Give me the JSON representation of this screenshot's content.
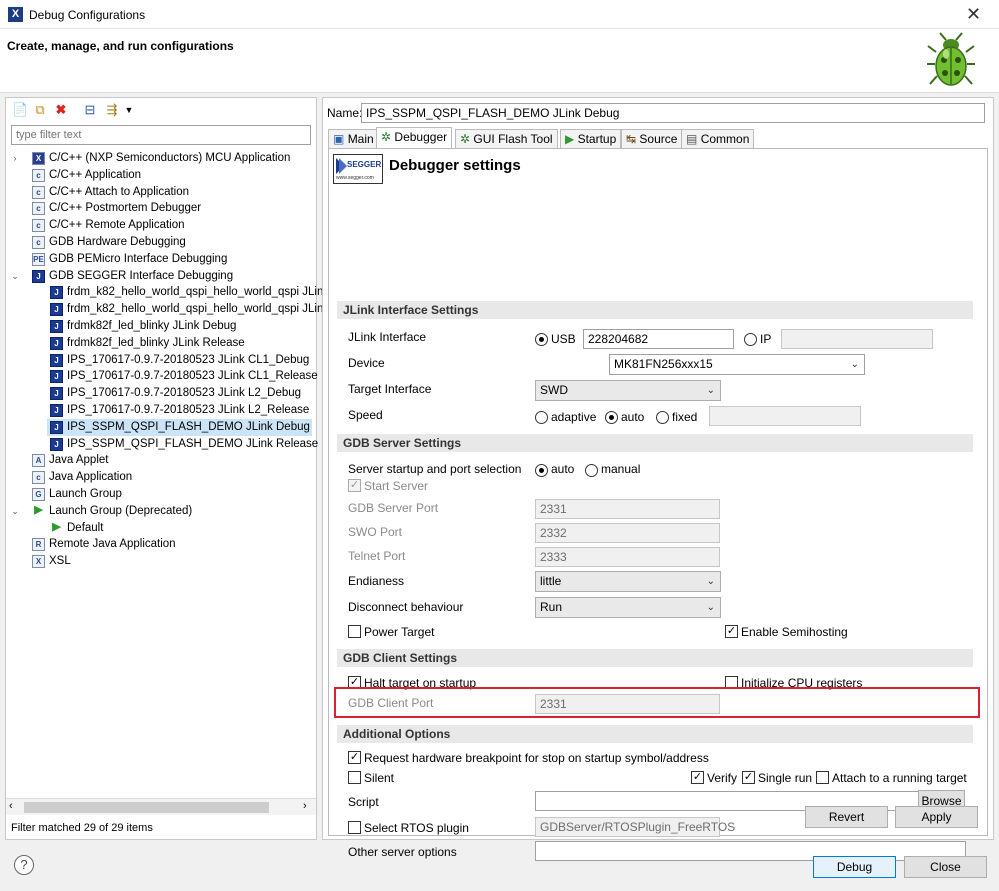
{
  "window": {
    "title": "Debug Configurations",
    "header": "Create, manage, and run configurations"
  },
  "sidebar": {
    "filter_placeholder": "type filter text",
    "items": [
      {
        "label": "C/C++ (NXP Semiconductors) MCU Application",
        "icon": "x",
        "level": 0,
        "twisty": "collapsed"
      },
      {
        "label": "C/C++ Application",
        "icon": "c",
        "level": 0
      },
      {
        "label": "C/C++ Attach to Application",
        "icon": "c",
        "level": 0
      },
      {
        "label": "C/C++ Postmortem Debugger",
        "icon": "c",
        "level": 0
      },
      {
        "label": "C/C++ Remote Application",
        "icon": "c",
        "level": 0
      },
      {
        "label": "GDB Hardware Debugging",
        "icon": "c",
        "level": 0
      },
      {
        "label": "GDB PEMicro Interface Debugging",
        "icon": "p",
        "level": 0
      },
      {
        "label": "GDB SEGGER Interface Debugging",
        "icon": "j",
        "level": 0,
        "twisty": "expanded"
      },
      {
        "label": "frdm_k82_hello_world_qspi_hello_world_qspi JLinl",
        "icon": "j",
        "level": 1
      },
      {
        "label": "frdm_k82_hello_world_qspi_hello_world_qspi JLinl",
        "icon": "j",
        "level": 1
      },
      {
        "label": "frdmk82f_led_blinky JLink Debug",
        "icon": "j",
        "level": 1
      },
      {
        "label": "frdmk82f_led_blinky JLink Release",
        "icon": "j",
        "level": 1
      },
      {
        "label": "IPS_170617-0.9.7-20180523 JLink CL1_Debug",
        "icon": "j",
        "level": 1
      },
      {
        "label": "IPS_170617-0.9.7-20180523 JLink CL1_Release",
        "icon": "j",
        "level": 1
      },
      {
        "label": "IPS_170617-0.9.7-20180523 JLink L2_Debug",
        "icon": "j",
        "level": 1
      },
      {
        "label": "IPS_170617-0.9.7-20180523 JLink L2_Release",
        "icon": "j",
        "level": 1
      },
      {
        "label": "IPS_SSPM_QSPI_FLASH_DEMO JLink Debug",
        "icon": "j",
        "level": 1,
        "selected": true
      },
      {
        "label": "IPS_SSPM_QSPI_FLASH_DEMO JLink Release",
        "icon": "j",
        "level": 1
      },
      {
        "label": "Java Applet",
        "icon": "a",
        "level": 0
      },
      {
        "label": "Java Application",
        "icon": "c",
        "level": 0
      },
      {
        "label": "Launch Group",
        "icon": "g",
        "level": 0
      },
      {
        "label": "Launch Group (Deprecated)",
        "icon": "run",
        "level": 0,
        "twisty": "expanded"
      },
      {
        "label": "Default",
        "icon": "run",
        "level": 1
      },
      {
        "label": "Remote Java Application",
        "icon": "r",
        "level": 0
      },
      {
        "label": "XSL",
        "icon": "xsl",
        "level": 0
      }
    ],
    "status": "Filter matched 29 of 29 items"
  },
  "config": {
    "name_label": "Name:",
    "name_value": "IPS_SSPM_QSPI_FLASH_DEMO JLink Debug",
    "tabs": [
      "Main",
      "Debugger",
      "GUI Flash Tool",
      "Startup",
      "Source",
      "Common"
    ],
    "active_tab": "Debugger",
    "panel_title": "Debugger settings",
    "logo_text": "SEGGER",
    "logo_url": "www.segger.com"
  },
  "jlink": {
    "section": "JLink Interface Settings",
    "interface_label": "JLink Interface",
    "usb_label": "USB",
    "usb_serial": "228204682",
    "ip_label": "IP",
    "device_label": "Device",
    "device_value": "MK81FN256xxx15",
    "target_label": "Target Interface",
    "target_value": "SWD",
    "speed_label": "Speed",
    "speed_options": [
      "adaptive",
      "auto",
      "fixed"
    ],
    "speed_selected": "auto"
  },
  "gdbserver": {
    "section": "GDB Server Settings",
    "startup_label": "Server startup and port selection",
    "startup_auto": "auto",
    "startup_manual": "manual",
    "start_server": "Start Server",
    "server_port_label": "GDB Server Port",
    "server_port": "2331",
    "swo_port_label": "SWO Port",
    "swo_port": "2332",
    "telnet_port_label": "Telnet Port",
    "telnet_port": "2333",
    "endianess_label": "Endianess",
    "endianess_value": "little",
    "disconnect_label": "Disconnect behaviour",
    "disconnect_value": "Run",
    "power_target": "Power Target",
    "semihosting": "Enable Semihosting"
  },
  "gdbclient": {
    "section": "GDB Client Settings",
    "halt": "Halt target on startup",
    "init_cpu": "Initialize CPU registers",
    "client_port_label": "GDB Client Port",
    "client_port": "2331"
  },
  "additional": {
    "section": "Additional Options",
    "hw_breakpoint": "Request hardware breakpoint for stop on startup symbol/address",
    "silent": "Silent",
    "verify": "Verify",
    "single_run": "Single run",
    "attach": "Attach to a running target",
    "script_label": "Script",
    "script_value": "",
    "browse": "Browse",
    "rtos": "Select RTOS plugin",
    "rtos_value": "GDBServer/RTOSPlugin_FreeRTOS",
    "other_label": "Other server options",
    "other_value": ""
  },
  "buttons": {
    "revert": "Revert",
    "apply": "Apply",
    "debug": "Debug",
    "close": "Close",
    "help": "?"
  },
  "colors": {
    "highlight": "#d9212f",
    "selection": "#cce4f7",
    "accent": "#1a3a94"
  }
}
